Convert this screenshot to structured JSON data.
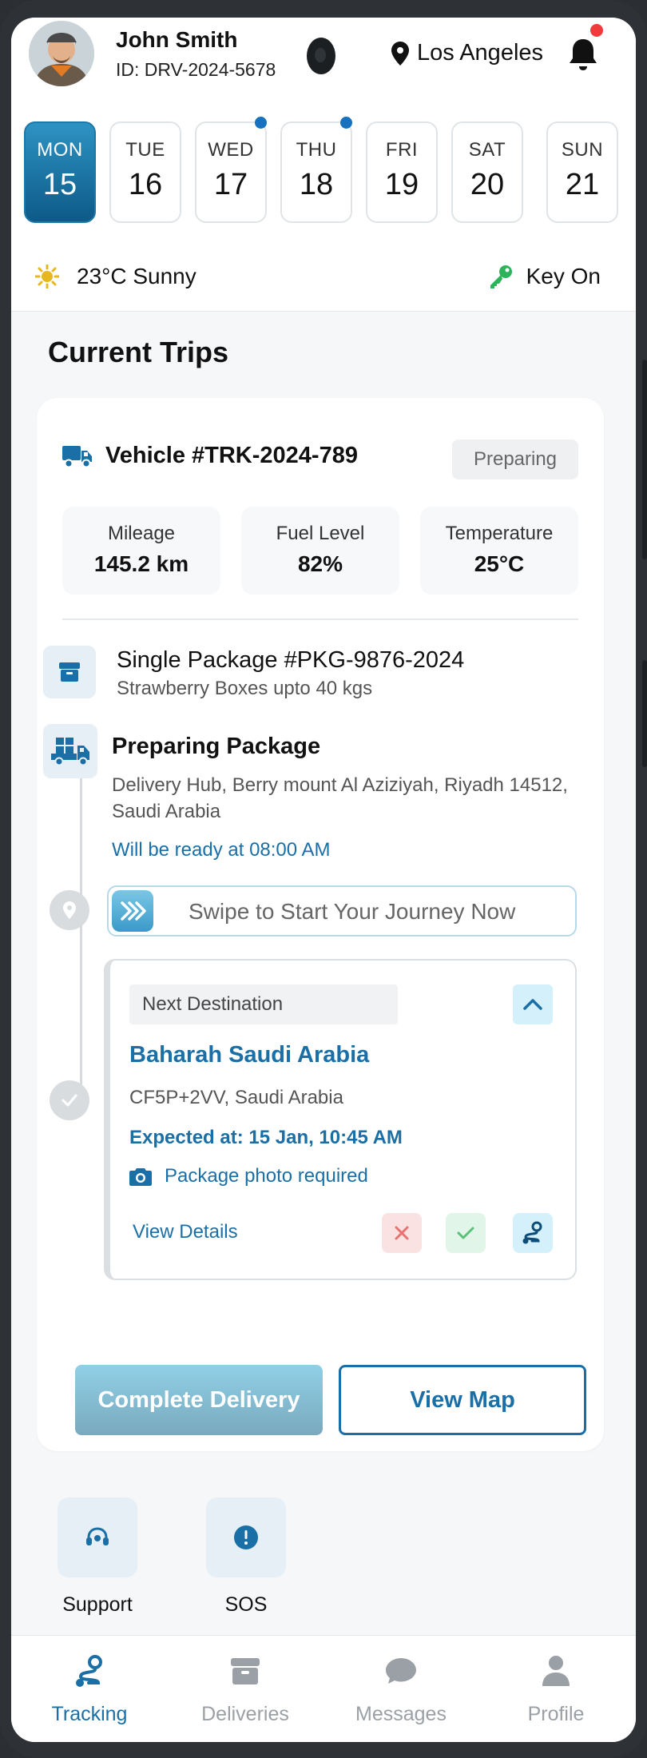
{
  "user": {
    "name": "John Smith",
    "id": "ID: DRV-2024-5678",
    "location": "Los Angeles"
  },
  "days": [
    {
      "name": "MON",
      "num": "15",
      "active": true,
      "dot": false
    },
    {
      "name": "TUE",
      "num": "16",
      "active": false,
      "dot": false
    },
    {
      "name": "WED",
      "num": "17",
      "active": false,
      "dot": true
    },
    {
      "name": "THU",
      "num": "18",
      "active": false,
      "dot": true
    },
    {
      "name": "FRI",
      "num": "19",
      "active": false,
      "dot": false
    },
    {
      "name": "SAT",
      "num": "20",
      "active": false,
      "dot": false
    },
    {
      "name": "SUN",
      "num": "21",
      "active": false,
      "dot": false
    }
  ],
  "weather": {
    "text": "23°C Sunny",
    "icon": "sun-icon"
  },
  "ignition": {
    "text": "Key On",
    "icon": "key-icon"
  },
  "section": {
    "title": "Current Trips"
  },
  "vehicle": {
    "title": "Vehicle #TRK-2024-789",
    "status": "Preparing",
    "icon": "truck-icon"
  },
  "stats": [
    {
      "label": "Mileage",
      "value": "145.2 km"
    },
    {
      "label": "Fuel Level",
      "value": "82%"
    },
    {
      "label": "Temperature",
      "value": "25°C"
    }
  ],
  "package": {
    "title": "Single Package #PKG-9876-2024",
    "subtitle": "Strawberry Boxes upto 40 kgs",
    "icon": "box-icon"
  },
  "preparing": {
    "title": "Preparing Package",
    "address": "Delivery Hub, Berry mount Al Aziziyah, Riyadh 14512, Saudi Arabia",
    "ready": "Will be ready at 08:00 AM",
    "icon": "delivery-truck-icon"
  },
  "swipe": {
    "text": "Swipe to Start Your Journey Now"
  },
  "destination": {
    "label": "Next Destination",
    "name": "Baharah Saudi Arabia",
    "code": "CF5P+2VV, Saudi Arabia",
    "eta": "Expected at: 15 Jan, 10:45 AM",
    "photo": "Package photo required",
    "details": "View Details"
  },
  "buttons": {
    "complete": "Complete Delivery",
    "map": "View Map"
  },
  "quick_actions": [
    {
      "label": "Support",
      "icon": "headset-icon"
    },
    {
      "label": "SOS",
      "icon": "alert-icon"
    }
  ],
  "nav": [
    {
      "label": "Tracking",
      "icon": "route-icon",
      "active": true
    },
    {
      "label": "Deliveries",
      "icon": "package-icon",
      "active": false
    },
    {
      "label": "Messages",
      "icon": "chat-icon",
      "active": false
    },
    {
      "label": "Profile",
      "icon": "person-icon",
      "active": false
    }
  ],
  "colors": {
    "accent": "#1a6fa6",
    "active_day_top": "#2d93c3",
    "active_day_bottom": "#0d5a88",
    "notification": "#ef3b3b",
    "key": "#2db45a",
    "sun": "#e6b81d"
  }
}
